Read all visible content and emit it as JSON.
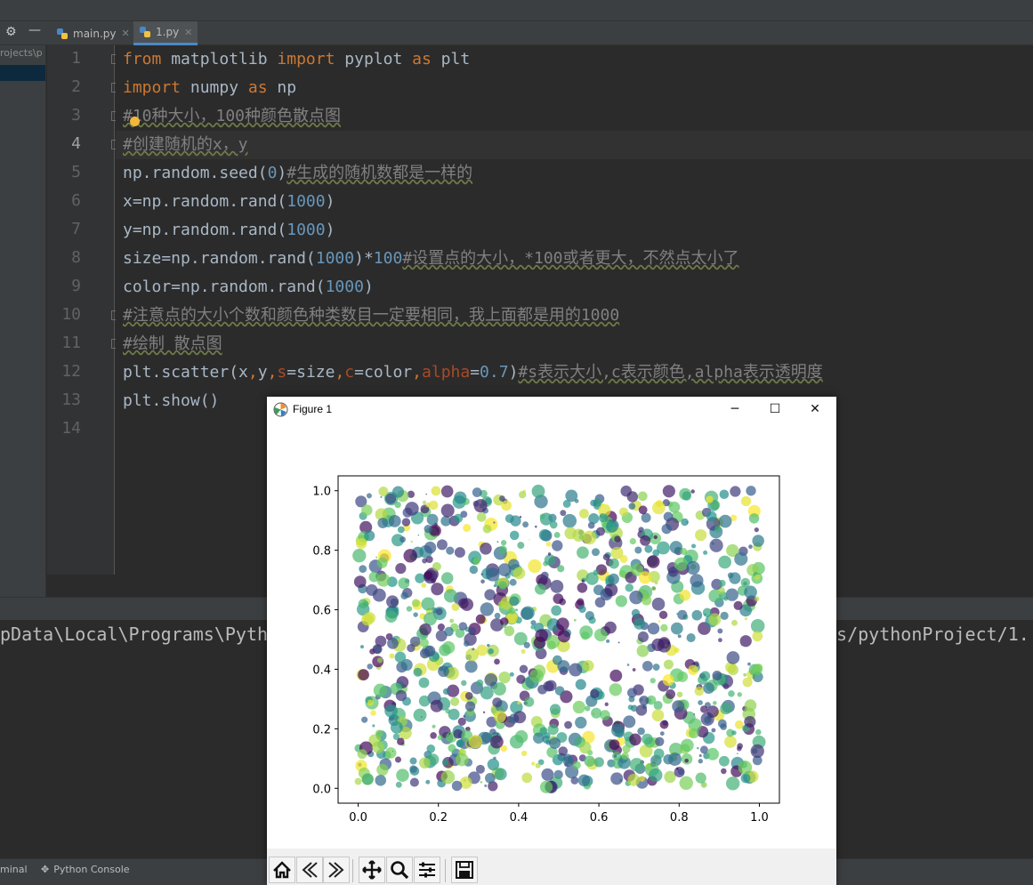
{
  "ide": {
    "tabs": [
      {
        "label": "main.py",
        "active": false
      },
      {
        "label": "1.py",
        "active": true
      }
    ],
    "project_path_fragment": "rojects\\p",
    "code_lines": [
      {
        "n": "1",
        "segs": [
          [
            "kw",
            "from"
          ],
          [
            "t",
            " matplotlib "
          ],
          [
            "kw",
            "import"
          ],
          [
            "t",
            " pyplot "
          ],
          [
            "kw",
            "as"
          ],
          [
            "t",
            " plt"
          ]
        ]
      },
      {
        "n": "2",
        "segs": [
          [
            "kw",
            "import"
          ],
          [
            "t",
            " numpy "
          ],
          [
            "kw",
            "as"
          ],
          [
            "t",
            " np"
          ]
        ]
      },
      {
        "n": "3",
        "segs": [
          [
            "cm",
            "#10种大小，100种颜色散点图"
          ]
        ]
      },
      {
        "n": "4",
        "segs": [
          [
            "cm",
            "#创建随机的x，y"
          ]
        ]
      },
      {
        "n": "5",
        "segs": [
          [
            "t",
            "np.random.seed("
          ],
          [
            "num",
            "0"
          ],
          [
            "t",
            ")"
          ],
          [
            "cm",
            "#生成的随机数都是一样的"
          ]
        ]
      },
      {
        "n": "6",
        "segs": [
          [
            "t",
            "x=np.random.rand("
          ],
          [
            "num",
            "1000"
          ],
          [
            "t",
            ")"
          ]
        ]
      },
      {
        "n": "7",
        "segs": [
          [
            "t",
            "y=np.random.rand("
          ],
          [
            "num",
            "1000"
          ],
          [
            "t",
            ")"
          ]
        ]
      },
      {
        "n": "8",
        "segs": [
          [
            "t",
            "size=np.random.rand("
          ],
          [
            "num",
            "1000"
          ],
          [
            "t",
            ")*"
          ],
          [
            "num",
            "100"
          ],
          [
            "cm",
            "#设置点的大小，*100或者更大，不然点太小了"
          ]
        ]
      },
      {
        "n": "9",
        "segs": [
          [
            "t",
            "color=np.random.rand("
          ],
          [
            "num",
            "1000"
          ],
          [
            "t",
            ")"
          ]
        ]
      },
      {
        "n": "10",
        "segs": [
          [
            "cm",
            "#注意点的大小个数和颜色种类数目一定要相同，我上面都是用的1000"
          ]
        ]
      },
      {
        "n": "11",
        "segs": [
          [
            "cm",
            "#绘制 散点图"
          ]
        ]
      },
      {
        "n": "12",
        "segs": [
          [
            "t",
            "plt.scatter(x"
          ],
          [
            "kw",
            ","
          ],
          [
            "t",
            "y"
          ],
          [
            "kw",
            ","
          ],
          [
            "par",
            "s"
          ],
          [
            "t",
            "=size"
          ],
          [
            "kw",
            ","
          ],
          [
            "par",
            "c"
          ],
          [
            "t",
            "=color"
          ],
          [
            "kw",
            ","
          ],
          [
            "par",
            "alpha"
          ],
          [
            "t",
            "="
          ],
          [
            "num",
            "0.7"
          ],
          [
            "t",
            ")"
          ],
          [
            "cm",
            "#s表示大小,c表示颜色,alpha表示透明度"
          ]
        ]
      },
      {
        "n": "13",
        "segs": [
          [
            "t",
            "plt.show()"
          ]
        ]
      },
      {
        "n": "14",
        "segs": []
      }
    ],
    "current_line": 4,
    "console_left": "pData\\Local\\Programs\\Pytho",
    "console_right": "ts/pythonProject/1.",
    "status_items": [
      "minal",
      "Python Console"
    ]
  },
  "figure": {
    "window_title": "Figure 1",
    "toolbar_buttons": [
      "home-icon",
      "back-icon",
      "forward-icon",
      "pan-icon",
      "zoom-icon",
      "configure-icon",
      "save-icon"
    ]
  },
  "chart_data": {
    "type": "scatter",
    "title": "",
    "xlabel": "",
    "ylabel": "",
    "xlim": [
      -0.05,
      1.05
    ],
    "ylim": [
      -0.05,
      1.05
    ],
    "xticks": [
      "0.0",
      "0.2",
      "0.4",
      "0.6",
      "0.8",
      "1.0"
    ],
    "yticks": [
      "0.0",
      "0.2",
      "0.4",
      "0.6",
      "0.8",
      "1.0"
    ],
    "n_points": 1000,
    "seed": 0,
    "size_scale": 100,
    "alpha": 0.7,
    "colormap": "viridis",
    "grid": false
  }
}
